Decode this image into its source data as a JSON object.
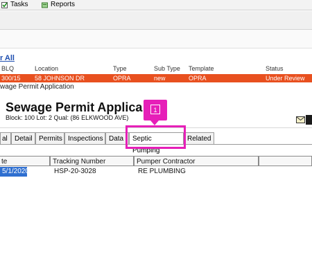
{
  "toolbar": {
    "tasks_label": "Tasks",
    "reports_label": "Reports"
  },
  "list": {
    "clear_all": "r All",
    "columns": [
      "BLQ",
      "Location",
      "Type",
      "Sub Type",
      "Template",
      "Status"
    ],
    "row": {
      "blq": "300/15",
      "location": "58 JOHNSON DR",
      "type": "OPRA",
      "sub_type": "new",
      "template": "OPRA",
      "status": "Under Review"
    }
  },
  "modal": {
    "window_title": "wage Permit Application",
    "title": "Sewage Permit Applica",
    "subtitle": "Block: 100 Lot: 2 Qual:  (86 ELKWOOD AVE)"
  },
  "tabs": [
    "al",
    "Detail",
    "Permits",
    "Inspections",
    "Data",
    "Septic Pumping",
    "Related"
  ],
  "active_tab": "Septic Pumping",
  "callout": {
    "number": "1",
    "color": "#e61fb8"
  },
  "pumping_table": {
    "columns": [
      "te",
      "Tracking Number",
      "Pumper Contractor"
    ],
    "rows": [
      {
        "date": "5/1/2020",
        "tracking": "HSP-20-3028",
        "contractor": "RE PLUMBING"
      }
    ]
  },
  "colors": {
    "row_highlight": "#e8501f",
    "selection": "#2f6fd0",
    "link": "#1f4fb0"
  }
}
